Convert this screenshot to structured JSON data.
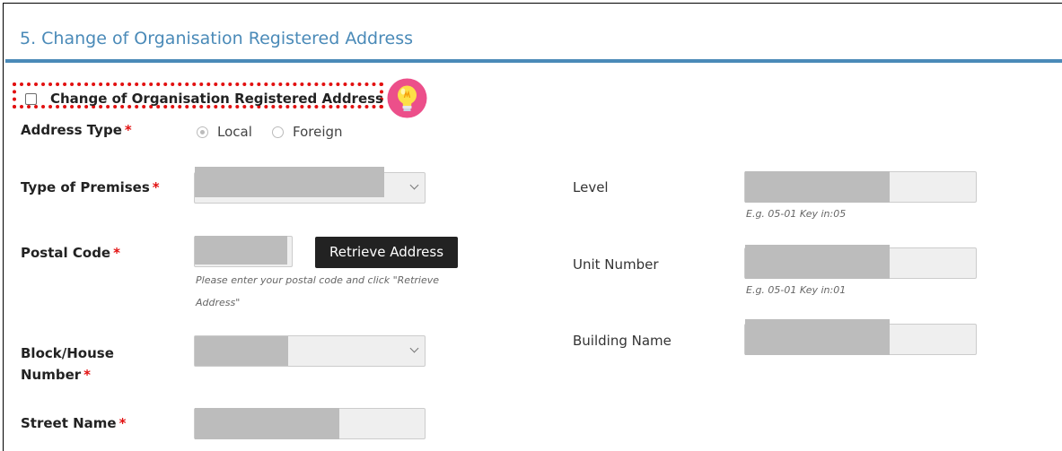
{
  "section": {
    "title": "5. Change of Organisation Registered Address"
  },
  "checkbox": {
    "label": "Change of Organisation Registered Address",
    "checked": false
  },
  "address_type": {
    "label": "Address Type",
    "required_mark": "*",
    "options": [
      "Local",
      "Foreign"
    ],
    "selected": "Local"
  },
  "type_of_premises": {
    "label": "Type of Premises",
    "required_mark": "*",
    "value": ""
  },
  "postal_code": {
    "label": "Postal Code",
    "required_mark": "*",
    "value": "",
    "button": "Retrieve Address",
    "hint_line1": "Please enter your postal code and click \"Retrieve",
    "hint_line2": "Address\""
  },
  "block_house": {
    "label_line1": "Block/House",
    "label_line2": "Number",
    "required_mark": "*",
    "value": ""
  },
  "street_name": {
    "label": "Street Name",
    "required_mark": "*",
    "value": ""
  },
  "level": {
    "label": "Level",
    "value": "",
    "hint": "E.g. 05-01 Key in:05"
  },
  "unit_number": {
    "label": "Unit Number",
    "value": "",
    "hint": "E.g. 05-01 Key in:01"
  },
  "building_name": {
    "label": "Building Name",
    "value": ""
  },
  "colors": {
    "accent": "#4a8ab8",
    "required": "#e21010",
    "highlight_border": "#e21010",
    "button_bg": "#222222"
  },
  "icons": {
    "tip": "lightbulb-icon"
  }
}
